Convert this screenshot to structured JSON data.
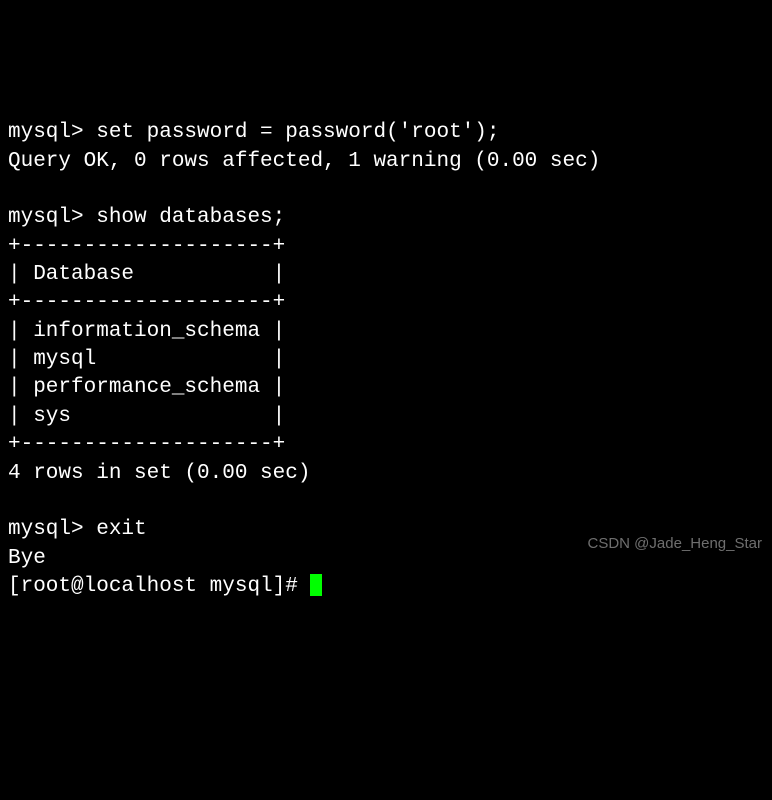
{
  "lines": {
    "l1_prompt": "mysql> ",
    "l1_cmd": "set password = password('root');",
    "l2": "Query OK, 0 rows affected, 1 warning (0.00 sec)",
    "l3": "",
    "l4_prompt": "mysql> ",
    "l4_cmd": "show databases;",
    "l5": "+--------------------+",
    "l6": "| Database           |",
    "l7": "+--------------------+",
    "l8": "| information_schema |",
    "l9": "| mysql              |",
    "l10": "| performance_schema |",
    "l11": "| sys                |",
    "l12": "+--------------------+",
    "l13": "4 rows in set (0.00 sec)",
    "l14": "",
    "l15_prompt": "mysql> ",
    "l15_cmd": "exit",
    "l16": "Bye",
    "l17_prompt": "[root@localhost mysql]# "
  },
  "watermark": "CSDN @Jade_Heng_Star"
}
